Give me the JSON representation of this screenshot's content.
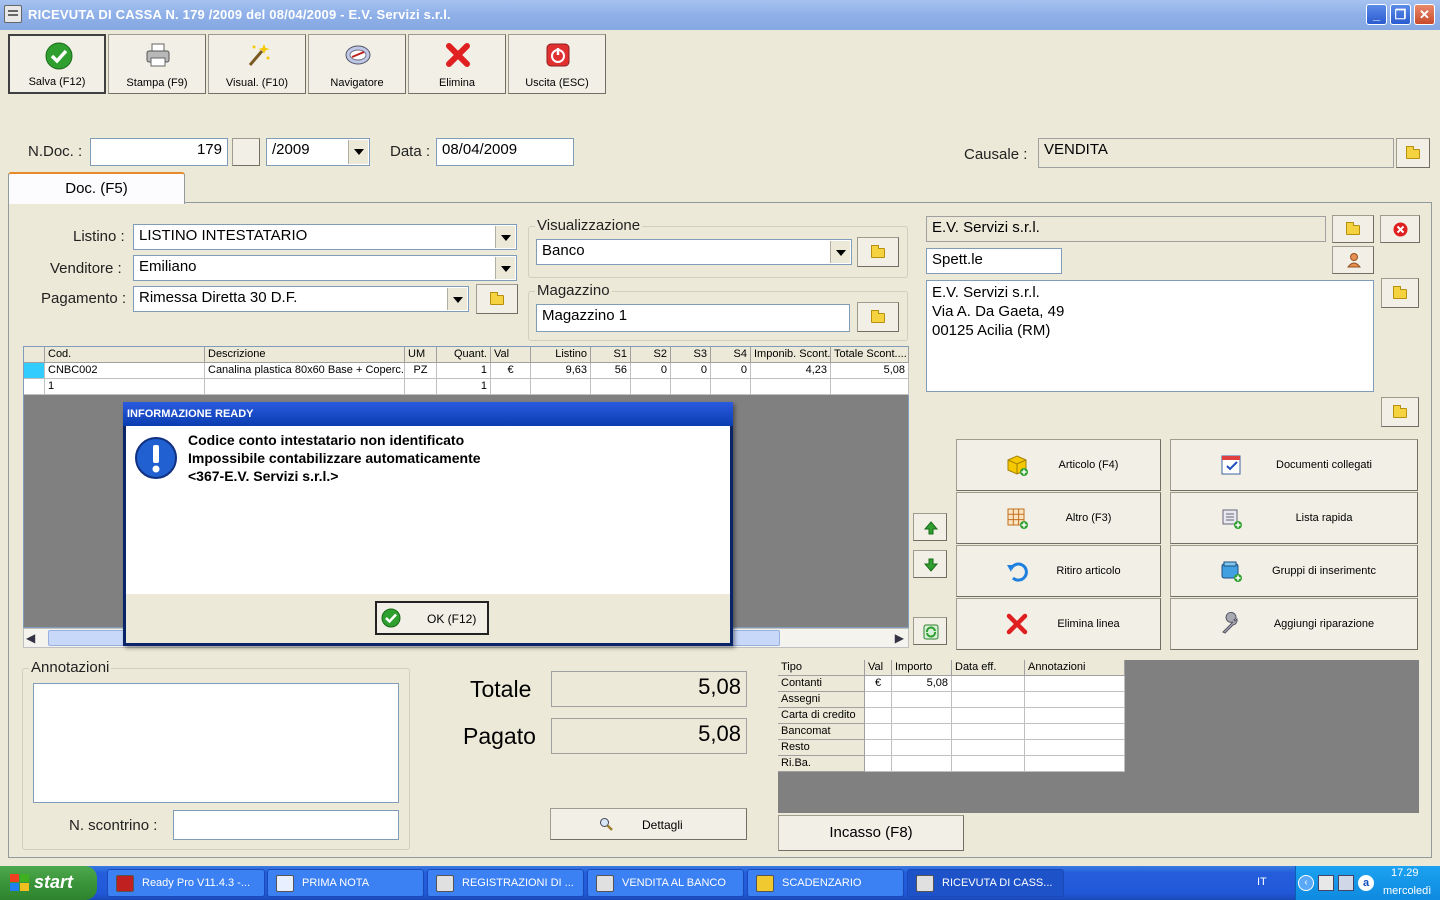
{
  "window": {
    "title": "RICEVUTA DI CASSA N. 179  /2009 del 08/04/2009 - E.V. Servizi s.r.l.",
    "min": "_",
    "max": "❐",
    "close": "✕"
  },
  "toolbar": [
    {
      "label": "Salva (F12)",
      "icon": "check-icon"
    },
    {
      "label": "Stampa (F9)",
      "icon": "printer-icon"
    },
    {
      "label": "Visual. (F10)",
      "icon": "magic-wand-icon"
    },
    {
      "label": "Navigatore",
      "icon": "compass-icon"
    },
    {
      "label": "Elimina",
      "icon": "delete-x-icon"
    },
    {
      "label": "Uscita (ESC)",
      "icon": "power-icon"
    }
  ],
  "header": {
    "ndoc_label": "N.Doc. :",
    "ndoc": "179",
    "year": "/2009",
    "data_label": "Data :",
    "data": "08/04/2009",
    "causale_label": "Causale :",
    "causale": "VENDITA"
  },
  "tab": {
    "label": "Doc. (F5)"
  },
  "form": {
    "listino_label": "Listino :",
    "listino": "LISTINO INTESTATARIO",
    "venditore_label": "Venditore :",
    "venditore": "Emiliano",
    "pagamento_label": "Pagamento :",
    "pagamento": "Rimessa Diretta 30 D.F.",
    "visual_title": "Visualizzazione",
    "visual": "Banco",
    "magazzino_title": "Magazzino",
    "magazzino": "Magazzino 1"
  },
  "cliente": {
    "name": "E.V. Servizi s.r.l.",
    "salutation": "Spett.le",
    "addr1": "E.V. Servizi s.r.l.",
    "addr2": "Via A. Da Gaeta, 49",
    "addr3": "00125 Acilia (RM)"
  },
  "grid": {
    "headers": [
      "Cod.",
      "Descrizione",
      "UM",
      "Quant.",
      "Val",
      "Listino",
      "S1",
      "S2",
      "S3",
      "S4",
      "Imponib. Scont.",
      "Totale Scont...."
    ],
    "row1": [
      "CNBC002",
      "Canalina plastica 80x60 Base + Coperc...",
      "PZ",
      "1",
      "€",
      "9,63",
      "56",
      "0",
      "0",
      "0",
      "4,23",
      "5,08"
    ],
    "row2": [
      "1",
      "",
      "",
      "1",
      "",
      "",
      "",
      "",
      "",
      "",
      "",
      ""
    ]
  },
  "actions": {
    "articolo": "Articolo (F4)",
    "documenti": "Documenti collegati",
    "altro": "Altro (F3)",
    "lista": "Lista rapida",
    "ritiro": "Ritiro articolo",
    "gruppi": "Gruppi di inserimentc",
    "elimina_linea": "Elimina linea",
    "riparazione": "Aggiungi riparazione"
  },
  "annotazioni": {
    "title": "Annotazioni",
    "scontrino_label": "N. scontrino :"
  },
  "totals": {
    "totale_label": "Totale",
    "totale": "5,08",
    "pagato_label": "Pagato",
    "pagato": "5,08",
    "dettagli": "Dettagli"
  },
  "payments": {
    "headers": [
      "Tipo",
      "Val",
      "Importo",
      "Data eff.",
      "Annotazioni"
    ],
    "rows": [
      {
        "tipo": "Contanti",
        "val": "€",
        "importo": "5,08"
      },
      {
        "tipo": "Assegni"
      },
      {
        "tipo": "Carta di credito"
      },
      {
        "tipo": "Bancomat"
      },
      {
        "tipo": "Resto"
      },
      {
        "tipo": "Ri.Ba."
      }
    ],
    "incasso": "Incasso (F8)"
  },
  "dialog": {
    "title": "INFORMAZIONE READY",
    "line1": "Codice conto intestatario non identificato",
    "line2": "Impossibile contabilizzare automaticamente",
    "line3": "<367-E.V. Servizi s.r.l.>",
    "ok": "OK (F12)"
  },
  "taskbar": {
    "start": "start",
    "tasks": [
      "Ready Pro V11.4.3 -...",
      "PRIMA NOTA",
      "REGISTRAZIONI DI ...",
      "VENDITA AL BANCO",
      "SCADENZARIO",
      "RICEVUTA DI CASS..."
    ],
    "lang": "IT",
    "time": "17.29",
    "day": "mercoledì"
  }
}
